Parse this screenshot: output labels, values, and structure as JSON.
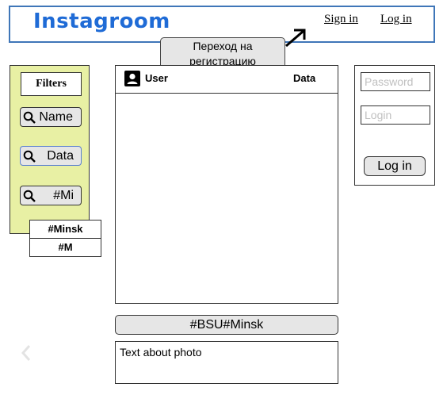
{
  "header": {
    "logo": "Instagroom",
    "sign_in": "Sign in",
    "log_in": "Log in"
  },
  "callout": {
    "line1": "Переход на",
    "line2": "регистрацию"
  },
  "filters": {
    "title": "Filters",
    "buttons": [
      {
        "label": "Name",
        "icon": "search-icon"
      },
      {
        "label": "Data",
        "icon": "search-icon"
      },
      {
        "label": "#Mi",
        "icon": "search-icon"
      }
    ],
    "suggestions": [
      "#Minsk",
      "#M"
    ]
  },
  "post": {
    "user_label": "User",
    "data_label": "Data",
    "tags": "#BSU#Minsk",
    "text": "Text about photo"
  },
  "login": {
    "password_placeholder": "Password",
    "login_placeholder": "Login",
    "button": "Log in"
  },
  "colors": {
    "logo": "#1f6bd6",
    "header_border": "#3f76b8",
    "filters_bg": "#e8f0a4",
    "button_bg": "#e6e6e6",
    "placeholder": "#c0c0c0"
  }
}
